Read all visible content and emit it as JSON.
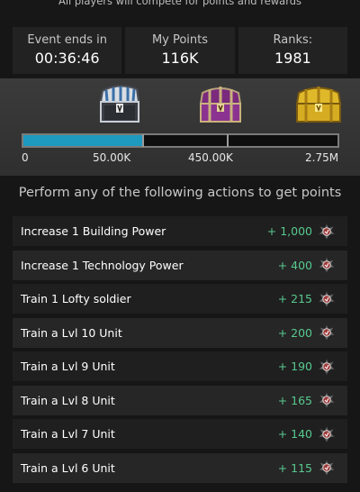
{
  "header": {
    "subtitle": "All players will compete for points and rewards"
  },
  "stats": [
    {
      "label": "Event ends in",
      "value": "00:36:46"
    },
    {
      "label": "My Points",
      "value": "116K"
    },
    {
      "label": "Ranks:",
      "value": "1981"
    }
  ],
  "progress": {
    "fill_fraction": 0.38,
    "milestones": [
      "0",
      "50.00K",
      "450.00K",
      "2.75M"
    ],
    "chests": [
      "silver-chest-icon",
      "purple-chest-icon",
      "gold-chest-icon"
    ]
  },
  "actions": {
    "title": "Perform any of the following actions to get points",
    "items": [
      {
        "name": "Increase 1 Building Power",
        "points": "+ 1,000"
      },
      {
        "name": "Increase 1 Technology Power",
        "points": "+ 400"
      },
      {
        "name": "Train 1 Lofty soldier",
        "points": "+ 215"
      },
      {
        "name": "Train a Lvl 10 Unit",
        "points": "+ 200"
      },
      {
        "name": "Train a Lvl 9 Unit",
        "points": "+ 190"
      },
      {
        "name": "Train a Lvl 8 Unit",
        "points": "+ 165"
      },
      {
        "name": "Train a Lvl 7 Unit",
        "points": "+ 140"
      },
      {
        "name": "Train a Lvl 6 Unit",
        "points": "+ 115"
      }
    ]
  },
  "colors": {
    "accent": "#1e9ac0",
    "points": "#58c98f"
  }
}
